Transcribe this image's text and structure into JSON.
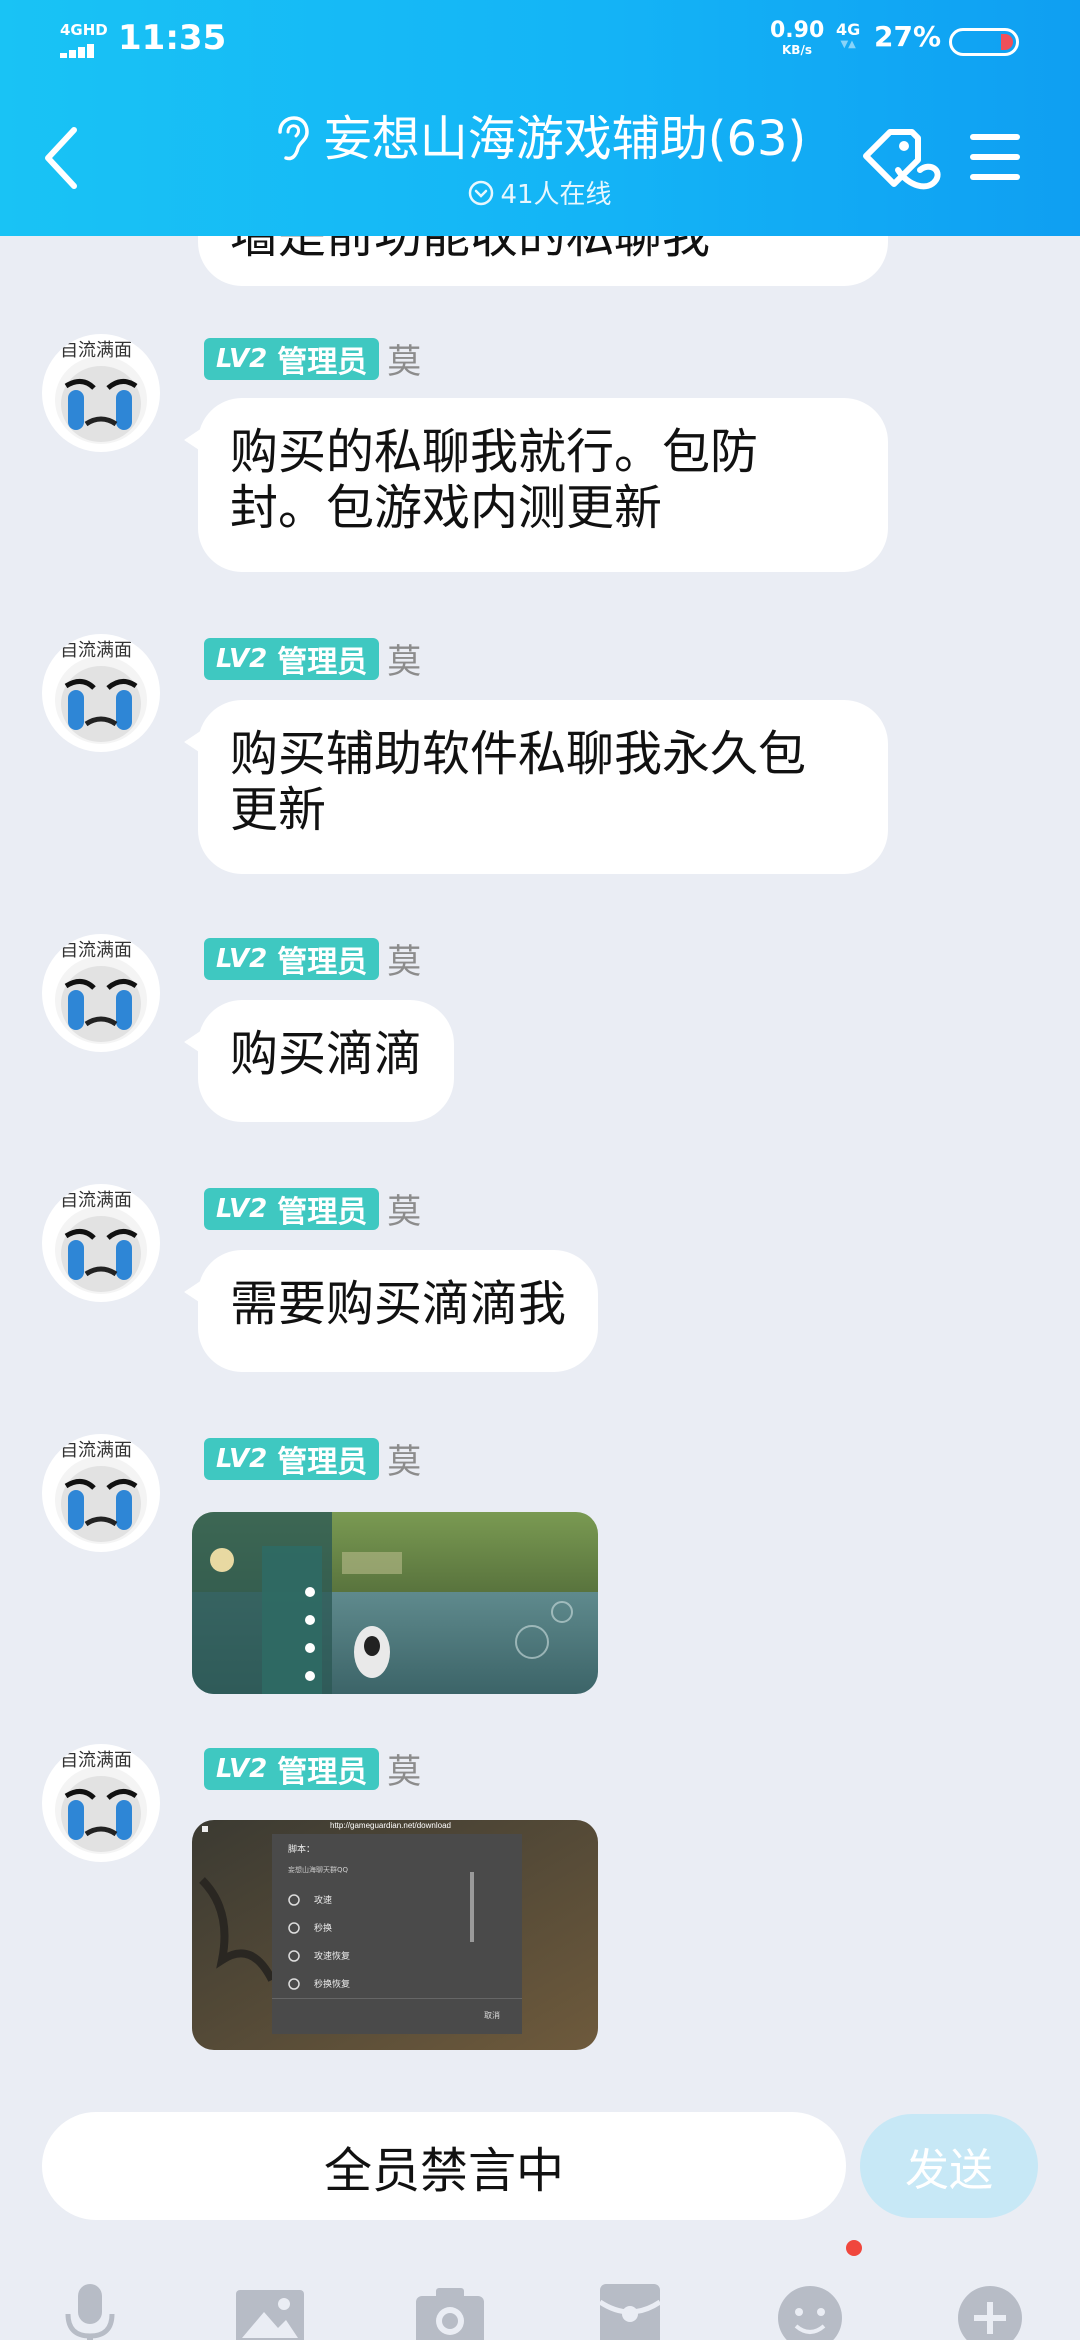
{
  "status_bar": {
    "network": "4GHD",
    "time": "11:35",
    "speed_value": "0.90",
    "speed_unit": "KB/s",
    "network2": "4G",
    "battery": "27%"
  },
  "header": {
    "title": "妄想山海游戏辅助(63)",
    "subtitle": "41人在线"
  },
  "messages": [
    {
      "type": "text",
      "badge_level": "LV2",
      "badge_role": "管理员",
      "sender": "莫",
      "text": "墙是前功能收的私聊我"
    },
    {
      "type": "text",
      "badge_level": "LV2",
      "badge_role": "管理员",
      "sender": "莫",
      "lines": [
        "购买的私聊我就行。包防",
        "封。包游戏内测更新"
      ]
    },
    {
      "type": "text",
      "badge_level": "LV2",
      "badge_role": "管理员",
      "sender": "莫",
      "lines": [
        "购买辅助软件私聊我永久包",
        "更新"
      ]
    },
    {
      "type": "text",
      "badge_level": "LV2",
      "badge_role": "管理员",
      "sender": "莫",
      "text": "购买滴滴"
    },
    {
      "type": "text",
      "badge_level": "LV2",
      "badge_role": "管理员",
      "sender": "莫",
      "text": "需要购买滴滴我"
    },
    {
      "type": "image",
      "badge_level": "LV2",
      "badge_role": "管理员",
      "sender": "莫"
    },
    {
      "type": "image",
      "badge_level": "LV2",
      "badge_role": "管理员",
      "sender": "莫",
      "screenshot": {
        "url": "http://gameguardian.net/download",
        "dialog_title": "脚本：",
        "dialog_subtitle": "妄想山海聊天群QQ",
        "options": [
          "攻速",
          "秒换",
          "攻速恢复",
          "秒换恢复"
        ],
        "cancel": "取消"
      }
    }
  ],
  "avatar_caption": "自流满面",
  "input": {
    "muted_text": "全员禁言中",
    "send_label": "发送"
  },
  "toolbar": [
    "microphone-icon",
    "image-icon",
    "camera-icon",
    "red-packet-icon",
    "emoji-icon",
    "plus-icon"
  ],
  "colors": {
    "header": "#14b4f6",
    "badge": "#3fc8c1",
    "background": "#eaedf4",
    "notification_dot": "#f0473d"
  }
}
